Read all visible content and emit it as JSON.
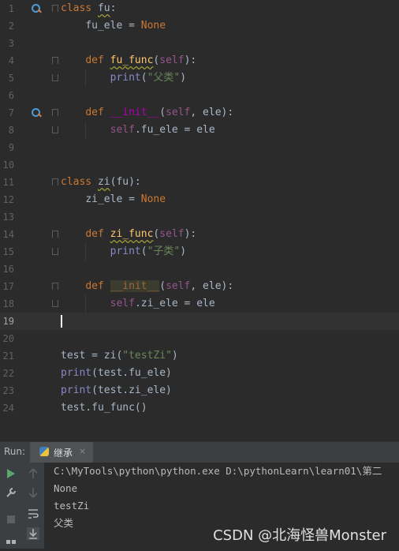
{
  "editor": {
    "line_numbers": [
      "1",
      "2",
      "3",
      "4",
      "5",
      "6",
      "7",
      "8",
      "9",
      "10",
      "11",
      "12",
      "13",
      "14",
      "15",
      "16",
      "17",
      "18",
      "19",
      "20",
      "21",
      "22",
      "23",
      "24"
    ],
    "code": {
      "l1_kw": "class",
      "l1_name": "fu",
      "l1_colon": ":",
      "l2": "fu_ele = ",
      "l2_none": "None",
      "l4_kw": "def",
      "l4_fn": "fu_func",
      "l4_open": "(",
      "l4_self": "self",
      "l4_close": "):",
      "l5_print": "print",
      "l5_open": "(",
      "l5_str": "\"父类\"",
      "l5_close": ")",
      "l7_kw": "def",
      "l7_fn": "__init__",
      "l7_open": "(",
      "l7_self": "self",
      "l7_rest": ", ele):",
      "l8_self": "self",
      "l8_rest": ".fu_ele = ele",
      "l11_kw": "class",
      "l11_name": "zi",
      "l11_rest": "(fu):",
      "l12": "zi_ele = ",
      "l12_none": "None",
      "l14_kw": "def",
      "l14_fn": "zi_func",
      "l14_open": "(",
      "l14_self": "self",
      "l14_close": "):",
      "l15_print": "print",
      "l15_open": "(",
      "l15_str": "\"子类\"",
      "l15_close": ")",
      "l17_kw": "def",
      "l17_fn": "__init__",
      "l17_open": "(",
      "l17_self": "self",
      "l17_rest": ", ele):",
      "l18_self": "self",
      "l18_rest": ".zi_ele = ele",
      "l21_a": "test = zi(",
      "l21_str": "\"testZi\"",
      "l21_b": ")",
      "l22_print": "print",
      "l22_rest": "(test.fu_ele)",
      "l23_print": "print",
      "l23_rest": "(test.zi_ele)",
      "l24": "test.fu_func()"
    }
  },
  "run_panel": {
    "label": "Run:",
    "tab_label": "继承",
    "tab_close": "×",
    "console": [
      "C:\\MyTools\\python\\python.exe D:\\pythonLearn\\learn01\\第二",
      "None",
      "testZi",
      "父类"
    ]
  },
  "watermark": "CSDN @北海怪兽Monster",
  "colors": {
    "background": "#2b2b2b",
    "keyword": "#cc7832",
    "function": "#ffc66d",
    "self": "#94558d",
    "string": "#6a8759",
    "builtin": "#8888c6",
    "run_green": "#59a869"
  },
  "icons": {
    "gutter": "override-marker-icon",
    "run_tab": "python-icon",
    "toolbar": [
      "run-icon",
      "up-arrow-icon",
      "wrench-icon",
      "down-arrow-icon",
      "stop-icon",
      "soft-wrap-icon",
      "scroll-to-end-icon",
      "layout-icon"
    ]
  }
}
